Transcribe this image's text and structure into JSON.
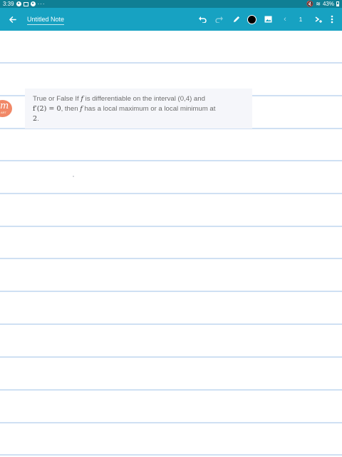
{
  "status_bar": {
    "time": "3:39",
    "battery": "43%",
    "overflow": "···"
  },
  "toolbar": {
    "note_title": "Untitled Note",
    "page_number": "1",
    "back_icon": "arrow-left-icon",
    "undo_icon": "undo-icon",
    "redo_icon": "redo-icon",
    "pen_icon": "pen-icon",
    "pen_color": "#000000",
    "image_icon": "image-icon",
    "prev_icon": "chevron-left-icon",
    "next_icon": "next-page-icon",
    "more_icon": "more-vertical-icon"
  },
  "colors": {
    "status_bar": "#0f7f94",
    "toolbar": "#17a2c2",
    "rule_line": "#cfe0f3",
    "card_bg": "#f5f6fa",
    "logo": "#f18867"
  },
  "question": {
    "part1": "True or False If ",
    "f1": "f",
    "part2": " is differentiable on the interval (0,4) and",
    "math1": "f′(2) = 0",
    "part3": ", then ",
    "f2": "f",
    "part4": " has a local maximum or a local minimum at",
    "math2": "2",
    "part5": "."
  },
  "logo": {
    "letter": "m",
    "sub": "ART"
  }
}
